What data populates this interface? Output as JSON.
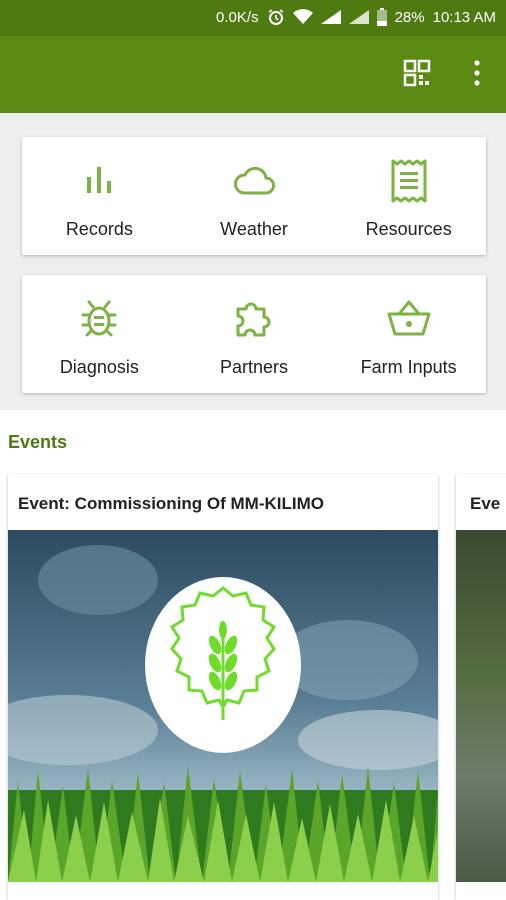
{
  "status_bar": {
    "speed": "0.0K/s",
    "battery": "28%",
    "time": "10:13 AM"
  },
  "colors": {
    "appbar": "#5a8a14",
    "status": "#4f7a12",
    "accent": "#7cb342"
  },
  "menu": {
    "row1": [
      {
        "label": "Records",
        "icon": "bar-chart-icon"
      },
      {
        "label": "Weather",
        "icon": "cloud-icon"
      },
      {
        "label": "Resources",
        "icon": "document-icon"
      }
    ],
    "row2": [
      {
        "label": "Diagnosis",
        "icon": "bug-icon"
      },
      {
        "label": "Partners",
        "icon": "puzzle-icon"
      },
      {
        "label": "Farm Inputs",
        "icon": "basket-icon"
      }
    ]
  },
  "events": {
    "title": "Events",
    "cards": [
      {
        "title": "Event: Commissioning Of MM-KILIMO"
      },
      {
        "title": "Eve"
      }
    ]
  }
}
